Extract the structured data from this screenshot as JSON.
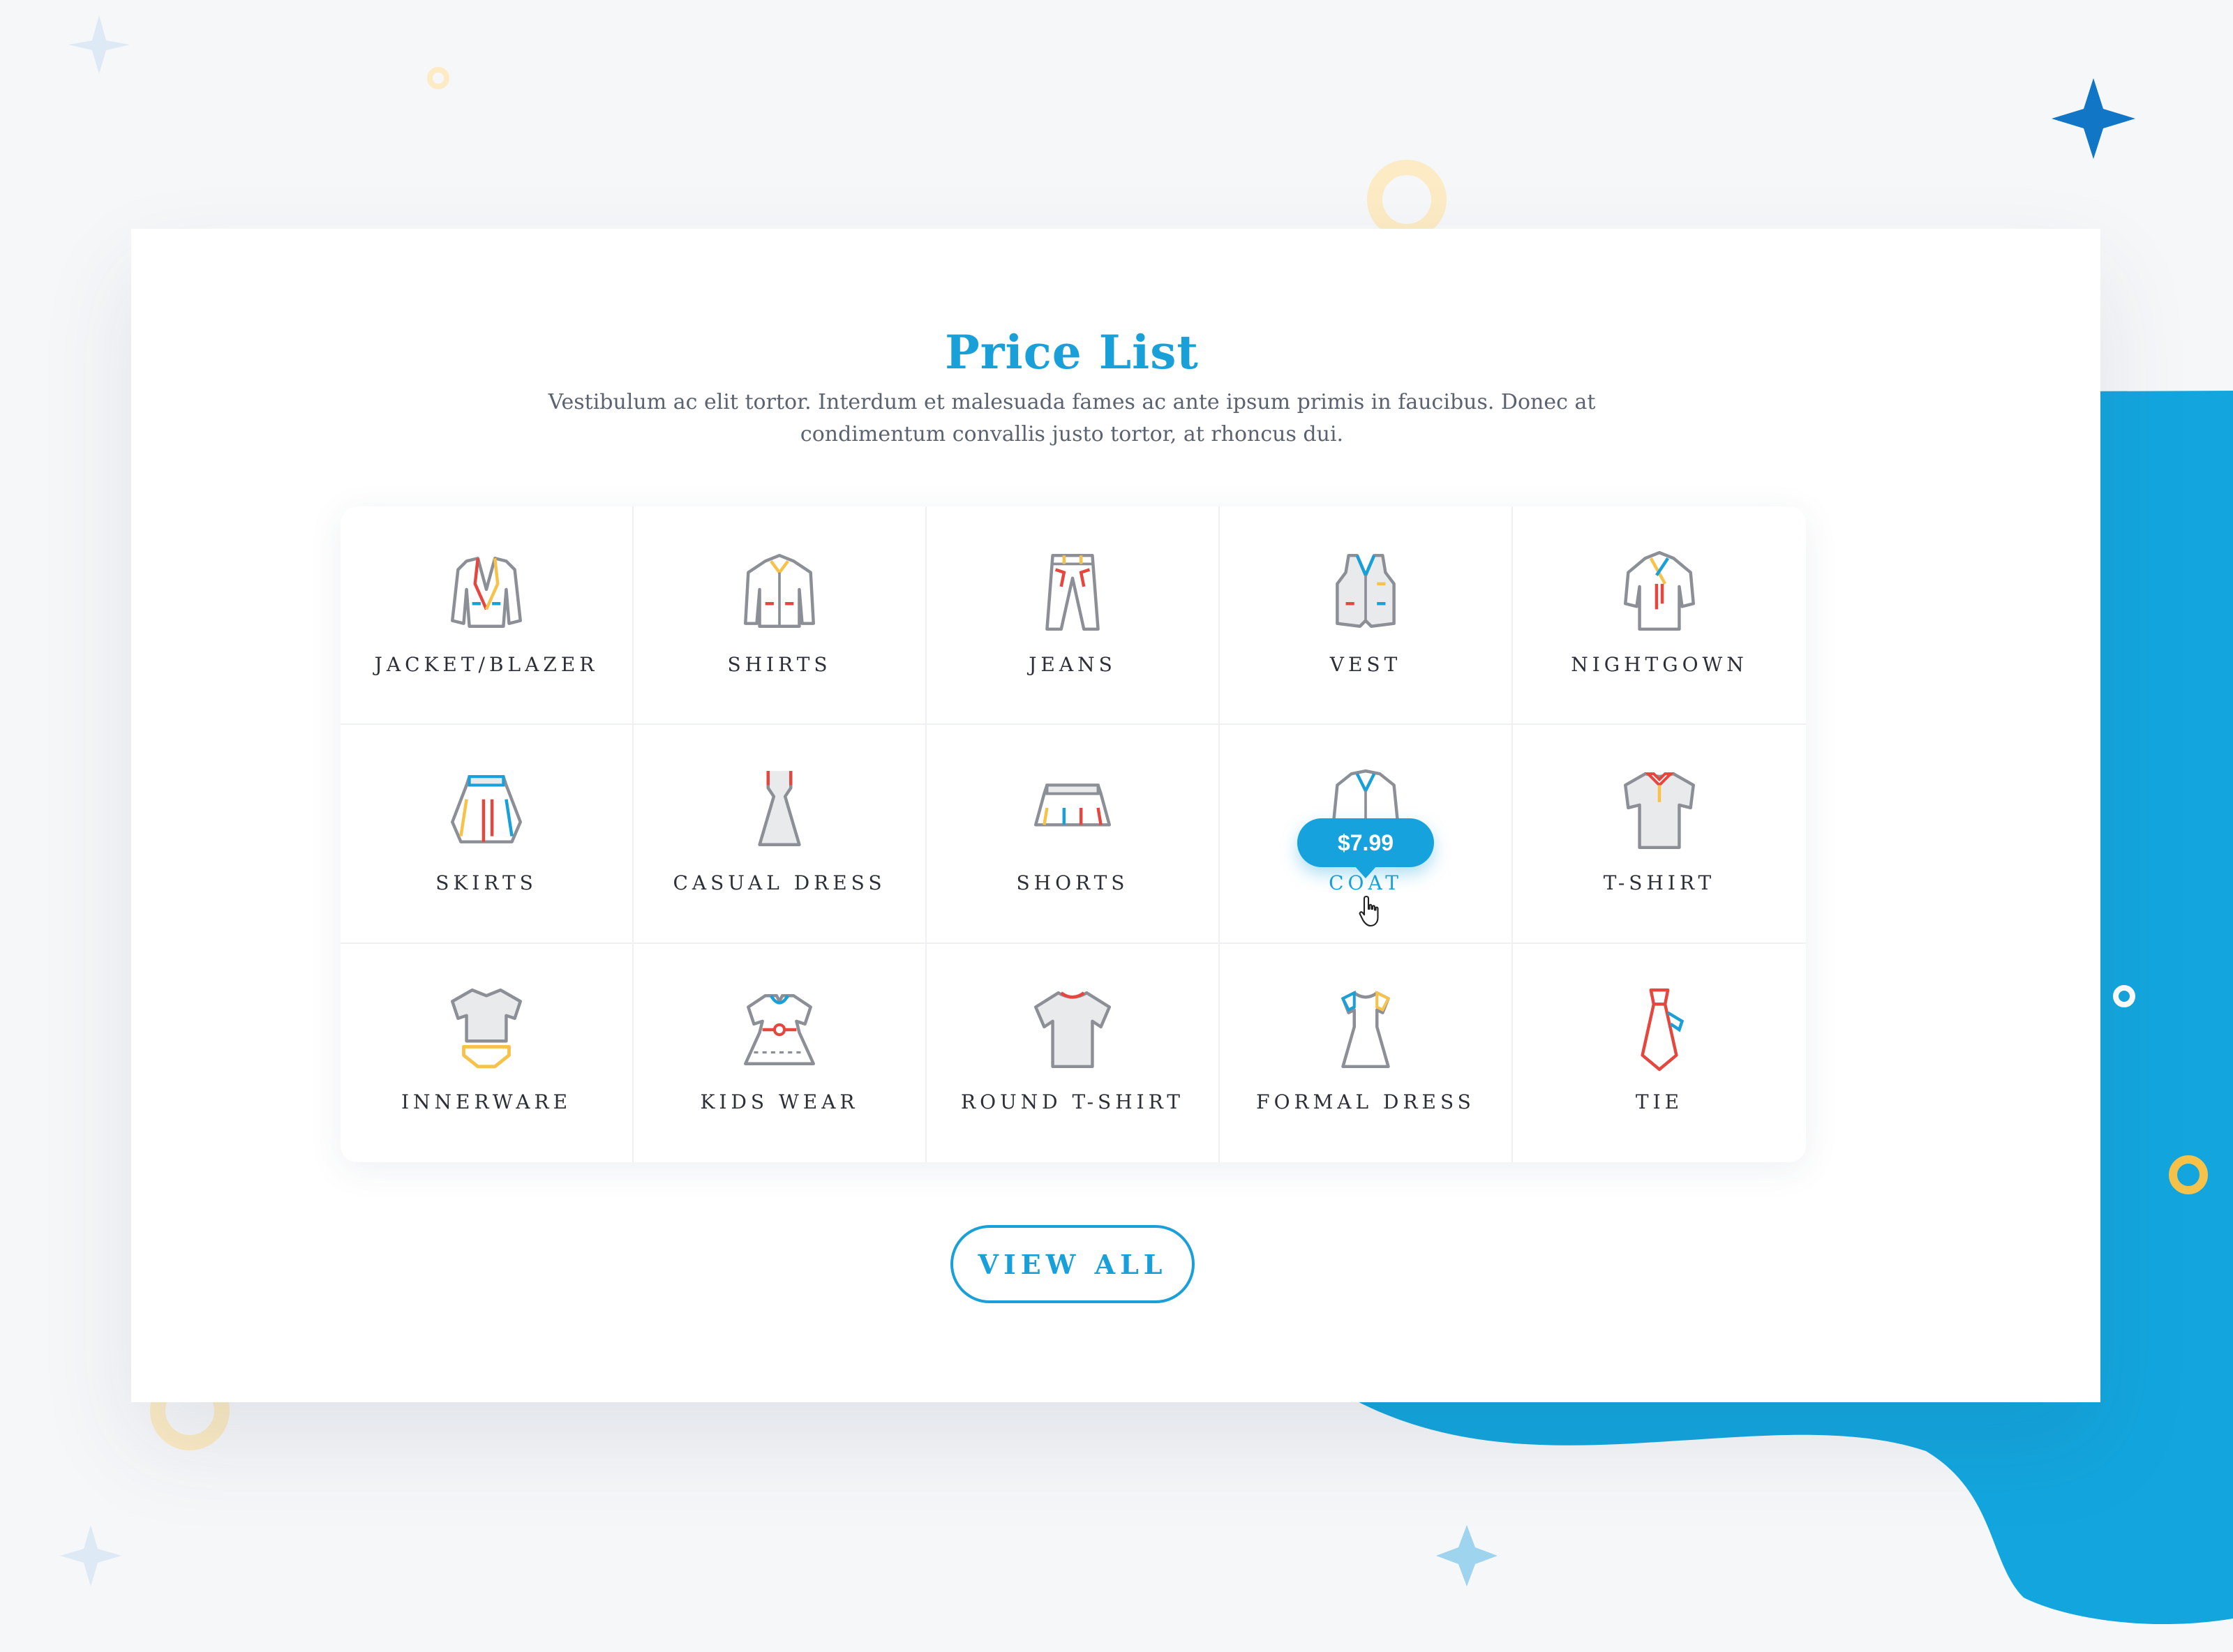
{
  "header": {
    "title": "Price List",
    "description": "Vestibulum ac elit tortor. Interdum et malesuada fames ac ante ipsum primis in faucibus. Donec at condimentum convallis justo tortor, at rhoncus dui."
  },
  "colors": {
    "accent": "#1aa0d8",
    "blob": "#13a6de",
    "yellow": "#f7c24a",
    "red": "#e5473f",
    "outline": "#8c8f96"
  },
  "items": [
    {
      "label": "JACKET/BLAZER",
      "icon": "jacket-icon"
    },
    {
      "label": "SHIRTS",
      "icon": "shirt-icon"
    },
    {
      "label": "JEANS",
      "icon": "jeans-icon"
    },
    {
      "label": "VEST",
      "icon": "vest-icon"
    },
    {
      "label": "NIGHTGOWN",
      "icon": "nightgown-icon"
    },
    {
      "label": "SKIRTS",
      "icon": "skirt-icon"
    },
    {
      "label": "CASUAL DRESS",
      "icon": "dress-icon"
    },
    {
      "label": "SHORTS",
      "icon": "shorts-icon"
    },
    {
      "label": "COAT",
      "icon": "coat-icon",
      "price": "$7.99",
      "hovered": true
    },
    {
      "label": "T-SHIRT",
      "icon": "polo-shirt-icon"
    },
    {
      "label": "INNERWARE",
      "icon": "innerwear-icon"
    },
    {
      "label": "KIDS WEAR",
      "icon": "kids-dress-icon"
    },
    {
      "label": "ROUND T-SHIRT",
      "icon": "round-tshirt-icon"
    },
    {
      "label": "FORMAL DRESS",
      "icon": "formal-dress-icon"
    },
    {
      "label": "TIE",
      "icon": "tie-icon"
    }
  ],
  "actions": {
    "view_all_label": "VIEW ALL"
  }
}
